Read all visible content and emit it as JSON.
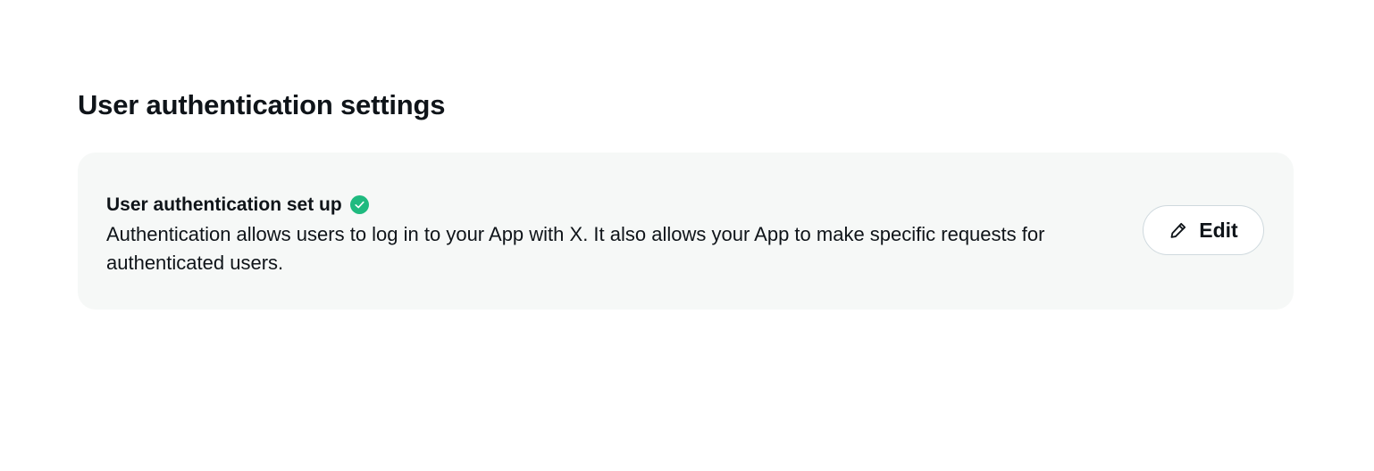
{
  "section": {
    "title": "User authentication settings"
  },
  "card": {
    "status_label": "User authentication set up",
    "status_icon": "check-circle-icon",
    "description": "Authentication allows users to log in to your App with X. It also allows your App to make specific requests for authenticated users.",
    "edit_button": {
      "label": "Edit",
      "icon": "pencil-icon"
    }
  },
  "colors": {
    "card_background": "#f6f8f7",
    "success_green": "#1fba7f",
    "text": "#0f1419",
    "button_border": "#cfd9de"
  }
}
